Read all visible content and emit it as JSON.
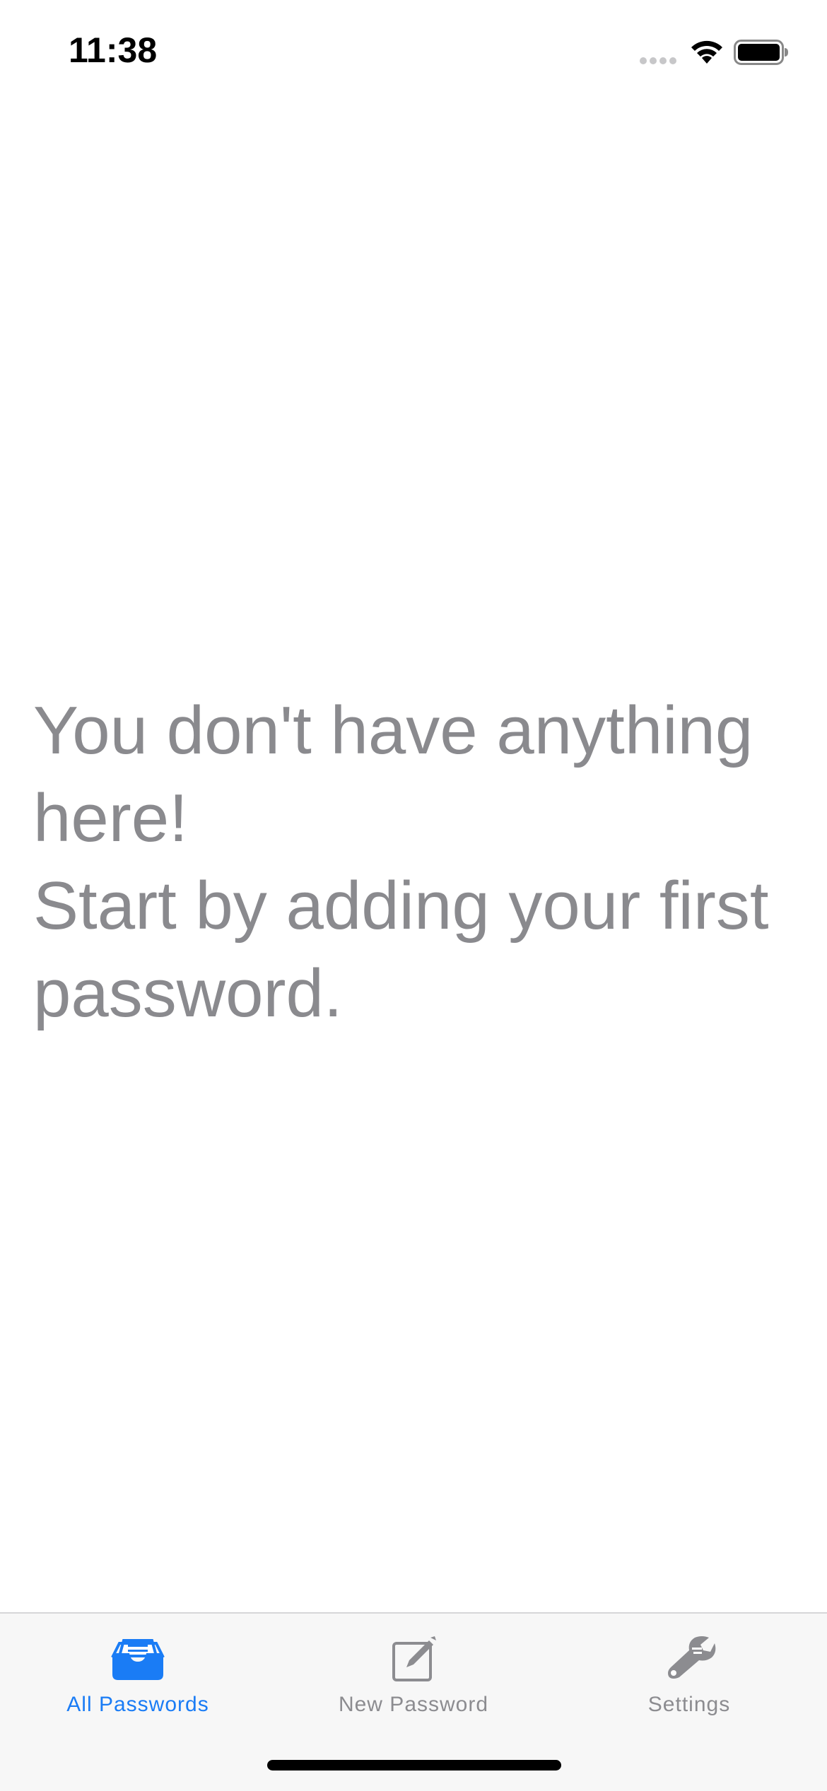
{
  "status_bar": {
    "time": "11:38"
  },
  "main": {
    "empty_message_line1": "You don't have anything here!",
    "empty_message_line2": "Start by adding your first password."
  },
  "tab_bar": {
    "tabs": [
      {
        "label": "All Passwords",
        "icon": "tray-icon",
        "active": true
      },
      {
        "label": "New Password",
        "icon": "compose-icon",
        "active": false
      },
      {
        "label": "Settings",
        "icon": "wrench-icon",
        "active": false
      }
    ]
  },
  "colors": {
    "accent": "#1a7cf5",
    "inactive": "#8c8c90",
    "message": "#8a8a8e",
    "tab_bar_bg": "#f7f7f7"
  }
}
